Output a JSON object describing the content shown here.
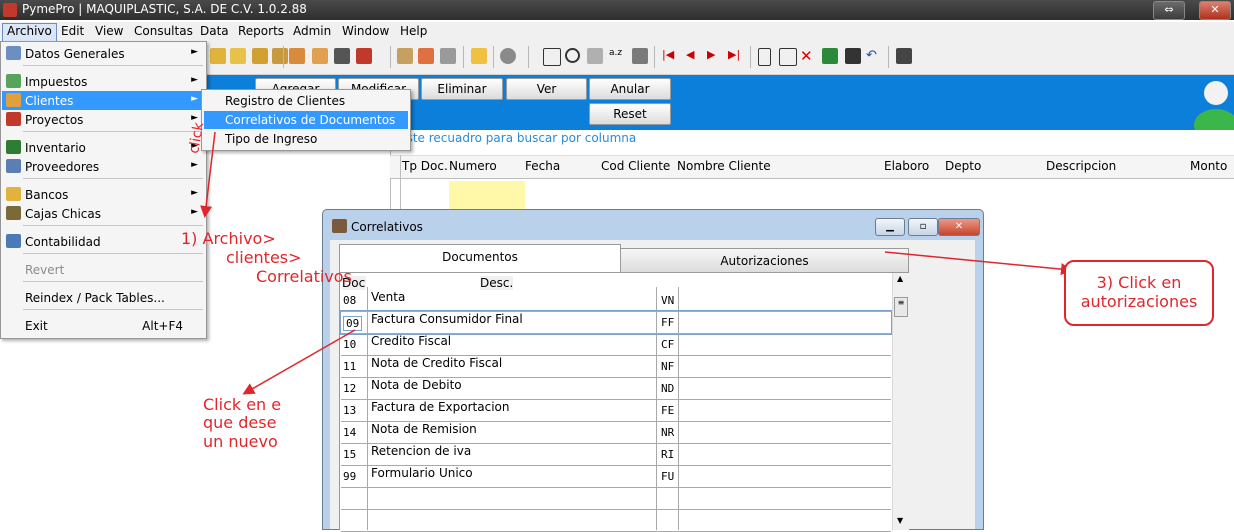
{
  "window": {
    "title": "PymePro | MAQUIPLASTIC, S.A. DE C.V. 1.0.2.88"
  },
  "menubar": [
    "Archivo",
    "Edit",
    "View",
    "Consultas",
    "Data",
    "Reports",
    "Admin",
    "Window",
    "Help"
  ],
  "archivo_menu": {
    "items": [
      {
        "label": "Datos Generales",
        "arrow": "►"
      },
      {
        "label": "Impuestos",
        "arrow": "►"
      },
      {
        "label": "Clientes",
        "arrow": "►"
      },
      {
        "label": "Proyectos",
        "arrow": "►"
      },
      {
        "label": "Inventario",
        "arrow": "►"
      },
      {
        "label": "Proveedores",
        "arrow": "►"
      },
      {
        "label": "Bancos",
        "arrow": "►"
      },
      {
        "label": "Cajas Chicas",
        "arrow": "►"
      },
      {
        "label": "Contabilidad"
      },
      {
        "label": "Revert"
      },
      {
        "label": "Reindex / Pack Tables..."
      },
      {
        "label": "Exit",
        "shortcut": "Alt+F4"
      }
    ]
  },
  "clientes_submenu": [
    "Registro de Clientes",
    "Correlativos de Documentos",
    "Tipo de Ingreso"
  ],
  "action_buttons": {
    "agregar": "Agregar",
    "modificar": "Modificar",
    "eliminar": "Eliminar",
    "ver": "Ver",
    "anular": "Anular",
    "reset": "Reset"
  },
  "search_hint": "e este recuadro para buscar por columna",
  "grid_columns": [
    "Tp Doc.",
    "Numero",
    "Fecha",
    "Cod Cliente",
    "Nombre Cliente",
    "Elaboro",
    "Depto",
    "Descripcion",
    "Monto"
  ],
  "dialog": {
    "title": "Correlativos",
    "tabs": [
      "Documentos",
      "Autorizaciones"
    ],
    "columns": {
      "doc": "Doc",
      "desc": "Desc."
    },
    "rows": [
      {
        "doc": "08",
        "desc": "Venta",
        "code": "VN"
      },
      {
        "doc": "09",
        "desc": "Factura Consumidor Final",
        "code": "FF"
      },
      {
        "doc": "10",
        "desc": "Credito Fiscal",
        "code": "CF"
      },
      {
        "doc": "11",
        "desc": "Nota de Credito Fiscal",
        "code": "NF"
      },
      {
        "doc": "12",
        "desc": "Nota de Debito",
        "code": "ND"
      },
      {
        "doc": "13",
        "desc": "Factura de Exportacion",
        "code": "FE"
      },
      {
        "doc": "14",
        "desc": "Nota de Remision",
        "code": "NR"
      },
      {
        "doc": "15",
        "desc": "Retencion de iva",
        "code": "RI"
      },
      {
        "doc": "99",
        "desc": "Formulario Unico",
        "code": "FU"
      }
    ]
  },
  "annotations": {
    "step1": "1) Archivo>",
    "step1b": "clientes>",
    "step1c": "Correlativos",
    "click": "click",
    "step2a": "Click en e",
    "step2b": "que dese",
    "step2c": "un nuevo",
    "step3a": "3) Click en",
    "step3b": "autorizaciones"
  },
  "colors": {
    "accent_blue": "#0b7fd9",
    "highlight": "#3399ff",
    "annotation_red": "#e0262c"
  }
}
